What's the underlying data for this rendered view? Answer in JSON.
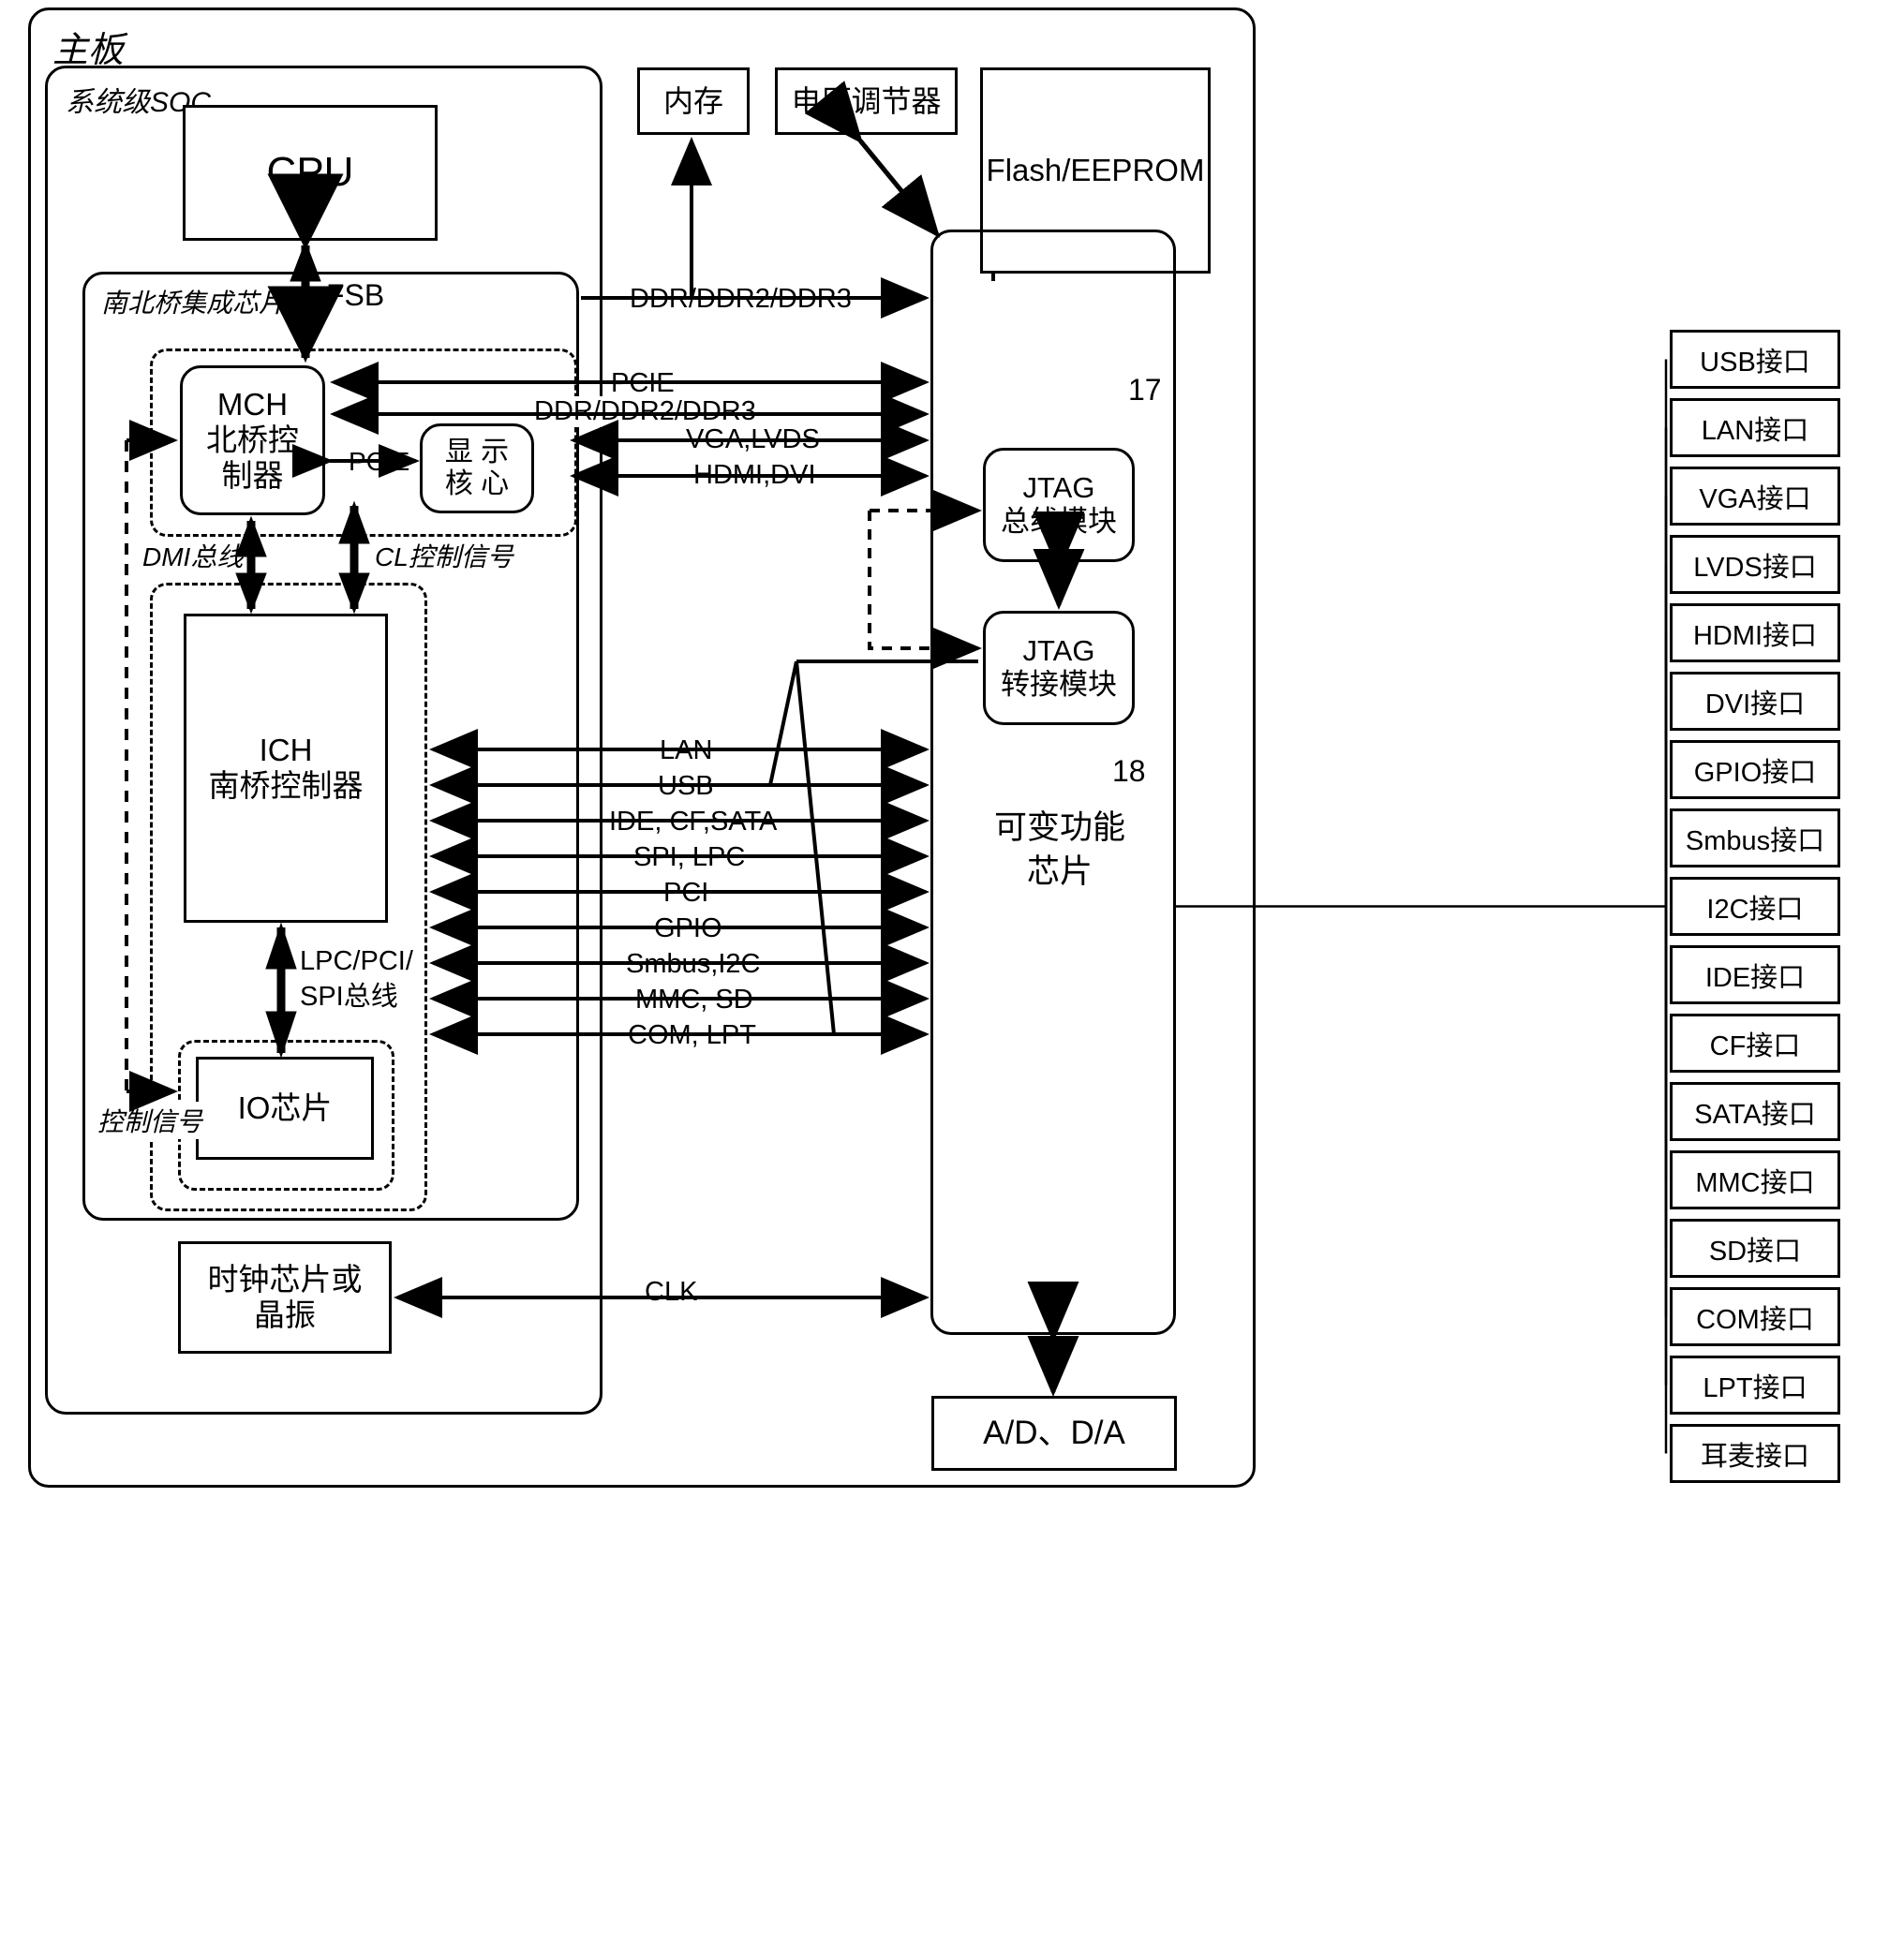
{
  "diagram": {
    "title": "主板",
    "soc_label": "系统级SOC",
    "bridge_label": "南北桥集成芯片"
  },
  "blocks": {
    "cpu": "CPU",
    "memory": "内存",
    "voltage_regulator": "电压调节器",
    "flash_eeprom": "Flash/EEPROM",
    "mch": "MCH\n北桥控\n制器",
    "mch_l1": "MCH",
    "mch_l2": "北桥控",
    "mch_l3": "制器",
    "display_core_l1": "显 示",
    "display_core_l2": "核 心",
    "ich_l1": "ICH",
    "ich_l2": "南桥控制器",
    "io_chip": "IO芯片",
    "clock_l1": "时钟芯片或",
    "clock_l2": "晶振",
    "jtag_bus_l1": "JTAG",
    "jtag_bus_l2": "总线模块",
    "jtag_adapter_l1": "JTAG",
    "jtag_adapter_l2": "转接模块",
    "variable_chip_l1": "可变功能",
    "variable_chip_l2": "芯片",
    "ad_da": "A/D、D/A"
  },
  "callouts": {
    "jtag_bus_ref": "17",
    "jtag_adapter_ref": "18"
  },
  "bus_labels": {
    "fsb": "FSB",
    "pcie_mch_display": "PCIE",
    "dmi": "DMI总线",
    "cl_control": "CL控制信号",
    "lpc_pci_spi_l1": "LPC/PCI/",
    "lpc_pci_spi_l2": "SPI总线",
    "control_signal": "控制信号"
  },
  "signals_top": [
    "DDR/DDR2/DDR3",
    "PCIE",
    "DDR/DDR2/DDR3",
    "VGA,LVDS",
    "HDMI,DVI"
  ],
  "signals_mid": [
    "LAN",
    "USB",
    "IDE, CF,SATA",
    "SPI, LPC",
    "PCI",
    "GPIO",
    "Smbus,I2C",
    "MMC, SD",
    "COM, LPT"
  ],
  "signals_bottom": [
    "CLK"
  ],
  "interfaces": [
    "USB接口",
    "LAN接口",
    "VGA接口",
    "LVDS接口",
    "HDMI接口",
    "DVI接口",
    "GPIO接口",
    "Smbus接口",
    "I2C接口",
    "IDE接口",
    "CF接口",
    "SATA接口",
    "MMC接口",
    "SD接口",
    "COM接口",
    "LPT接口",
    "耳麦接口"
  ],
  "colors": {
    "line": "#000000",
    "background": "#ffffff"
  }
}
